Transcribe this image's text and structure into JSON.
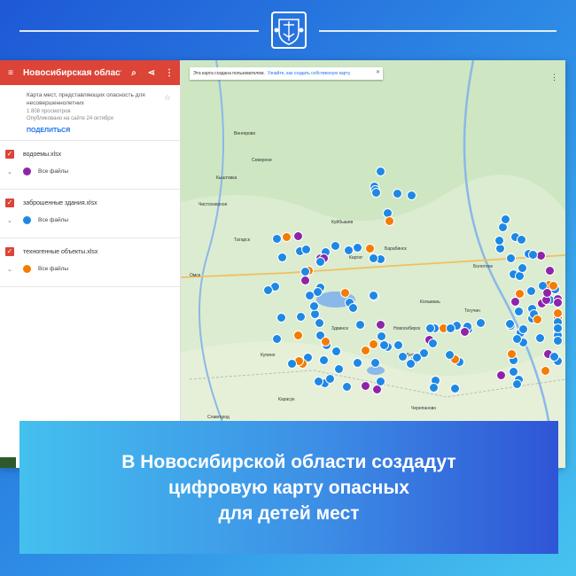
{
  "header": {
    "emblem_icon": "novosibirsk-coat-of-arms-icon"
  },
  "sidebar": {
    "title": "Новосибирская область...",
    "menu_icon": "hamburger-menu-icon",
    "search_icon": "search-icon",
    "share_icon": "share-icon",
    "more_icon": "more-vert-icon",
    "description": "Карта мест, представляющих опасность для несовершеннолетних",
    "views": "1 808 просмотров",
    "published": "Опубликовано на сайте 24 октября",
    "share_label": "ПОДЕЛИТЬСЯ",
    "layers": [
      {
        "name": "водоемы.xlsx",
        "files_label": "Все файлы",
        "color": "#8e24aa"
      },
      {
        "name": "заброшенные здания.xlsx",
        "files_label": "Все файлы",
        "color": "#1e88e5"
      },
      {
        "name": "техногенные объекты.xlsx",
        "files_label": "Все файлы",
        "color": "#f57c00"
      }
    ]
  },
  "map": {
    "notice_text": "Эта карта создана пользователем.",
    "notice_link": "Узнайте, как создать собственную карту",
    "towns": [
      "Новосибирск",
      "Омск",
      "Каргат",
      "Барабинск",
      "Татарск",
      "Купино",
      "Карасук",
      "Славгород",
      "Камень-на-Оби",
      "Бердск",
      "Куйбышев",
      "Колывань",
      "Венгерово",
      "Северное",
      "Кыштовка",
      "Здвинск",
      "Чистоозерное",
      "Тогучин",
      "Болотное",
      "Черепаново"
    ]
  },
  "caption": "В Новосибирской области создадут\nцифровую карту опасных\nдля детей мест",
  "colors": {
    "water": "#8e24aa",
    "buildings": "#1e88e5",
    "technogenic": "#f57c00",
    "accent_red": "#db4437"
  }
}
